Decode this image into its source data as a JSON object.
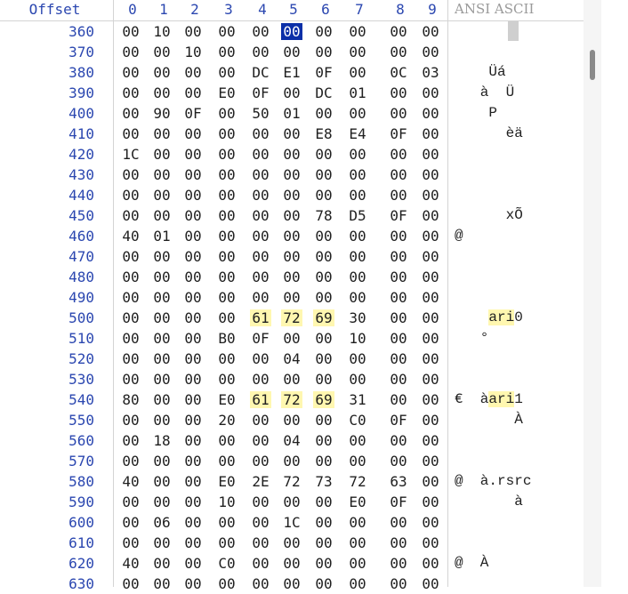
{
  "header": {
    "offset_label": "Offset",
    "columns": [
      "0",
      "1",
      "2",
      "3",
      "4",
      "5",
      "6",
      "7",
      "8",
      "9"
    ],
    "ascii_label": "ANSI ASCII"
  },
  "rows": [
    {
      "offset": "360",
      "bytes": [
        "00",
        "10",
        "00",
        "00",
        "00",
        "00",
        "00",
        "00",
        "00",
        "00"
      ],
      "ascii": ""
    },
    {
      "offset": "370",
      "bytes": [
        "00",
        "00",
        "10",
        "00",
        "00",
        "00",
        "00",
        "00",
        "00",
        "00"
      ],
      "ascii": ""
    },
    {
      "offset": "380",
      "bytes": [
        "00",
        "00",
        "00",
        "00",
        "DC",
        "E1",
        "0F",
        "00",
        "0C",
        "03"
      ],
      "ascii": "    Üá"
    },
    {
      "offset": "390",
      "bytes": [
        "00",
        "00",
        "00",
        "E0",
        "0F",
        "00",
        "DC",
        "01",
        "00",
        "00"
      ],
      "ascii": "   à  Ü"
    },
    {
      "offset": "400",
      "bytes": [
        "00",
        "90",
        "0F",
        "00",
        "50",
        "01",
        "00",
        "00",
        "00",
        "00"
      ],
      "ascii": "    P"
    },
    {
      "offset": "410",
      "bytes": [
        "00",
        "00",
        "00",
        "00",
        "00",
        "00",
        "E8",
        "E4",
        "0F",
        "00"
      ],
      "ascii": "      èä"
    },
    {
      "offset": "420",
      "bytes": [
        "1C",
        "00",
        "00",
        "00",
        "00",
        "00",
        "00",
        "00",
        "00",
        "00"
      ],
      "ascii": ""
    },
    {
      "offset": "430",
      "bytes": [
        "00",
        "00",
        "00",
        "00",
        "00",
        "00",
        "00",
        "00",
        "00",
        "00"
      ],
      "ascii": ""
    },
    {
      "offset": "440",
      "bytes": [
        "00",
        "00",
        "00",
        "00",
        "00",
        "00",
        "00",
        "00",
        "00",
        "00"
      ],
      "ascii": ""
    },
    {
      "offset": "450",
      "bytes": [
        "00",
        "00",
        "00",
        "00",
        "00",
        "00",
        "78",
        "D5",
        "0F",
        "00"
      ],
      "ascii": "      xÕ"
    },
    {
      "offset": "460",
      "bytes": [
        "40",
        "01",
        "00",
        "00",
        "00",
        "00",
        "00",
        "00",
        "00",
        "00"
      ],
      "ascii": "@"
    },
    {
      "offset": "470",
      "bytes": [
        "00",
        "00",
        "00",
        "00",
        "00",
        "00",
        "00",
        "00",
        "00",
        "00"
      ],
      "ascii": ""
    },
    {
      "offset": "480",
      "bytes": [
        "00",
        "00",
        "00",
        "00",
        "00",
        "00",
        "00",
        "00",
        "00",
        "00"
      ],
      "ascii": ""
    },
    {
      "offset": "490",
      "bytes": [
        "00",
        "00",
        "00",
        "00",
        "00",
        "00",
        "00",
        "00",
        "00",
        "00"
      ],
      "ascii": ""
    },
    {
      "offset": "500",
      "bytes": [
        "00",
        "00",
        "00",
        "00",
        "61",
        "72",
        "69",
        "30",
        "00",
        "00"
      ],
      "ascii": "    ari0",
      "ascii_hl": [
        4,
        7
      ]
    },
    {
      "offset": "510",
      "bytes": [
        "00",
        "00",
        "00",
        "B0",
        "0F",
        "00",
        "00",
        "10",
        "00",
        "00"
      ],
      "ascii": "   °"
    },
    {
      "offset": "520",
      "bytes": [
        "00",
        "00",
        "00",
        "00",
        "00",
        "04",
        "00",
        "00",
        "00",
        "00"
      ],
      "ascii": ""
    },
    {
      "offset": "530",
      "bytes": [
        "00",
        "00",
        "00",
        "00",
        "00",
        "00",
        "00",
        "00",
        "00",
        "00"
      ],
      "ascii": ""
    },
    {
      "offset": "540",
      "bytes": [
        "80",
        "00",
        "00",
        "E0",
        "61",
        "72",
        "69",
        "31",
        "00",
        "00"
      ],
      "ascii": "€  àari1",
      "ascii_hl": [
        4,
        7
      ]
    },
    {
      "offset": "550",
      "bytes": [
        "00",
        "00",
        "00",
        "20",
        "00",
        "00",
        "00",
        "C0",
        "0F",
        "00"
      ],
      "ascii": "       À"
    },
    {
      "offset": "560",
      "bytes": [
        "00",
        "18",
        "00",
        "00",
        "00",
        "04",
        "00",
        "00",
        "00",
        "00"
      ],
      "ascii": ""
    },
    {
      "offset": "570",
      "bytes": [
        "00",
        "00",
        "00",
        "00",
        "00",
        "00",
        "00",
        "00",
        "00",
        "00"
      ],
      "ascii": ""
    },
    {
      "offset": "580",
      "bytes": [
        "40",
        "00",
        "00",
        "E0",
        "2E",
        "72",
        "73",
        "72",
        "63",
        "00"
      ],
      "ascii": "@  à.rsrc"
    },
    {
      "offset": "590",
      "bytes": [
        "00",
        "00",
        "00",
        "10",
        "00",
        "00",
        "00",
        "E0",
        "0F",
        "00"
      ],
      "ascii": "       à"
    },
    {
      "offset": "600",
      "bytes": [
        "00",
        "06",
        "00",
        "00",
        "00",
        "1C",
        "00",
        "00",
        "00",
        "00"
      ],
      "ascii": ""
    },
    {
      "offset": "610",
      "bytes": [
        "00",
        "00",
        "00",
        "00",
        "00",
        "00",
        "00",
        "00",
        "00",
        "00"
      ],
      "ascii": ""
    },
    {
      "offset": "620",
      "bytes": [
        "40",
        "00",
        "00",
        "C0",
        "00",
        "00",
        "00",
        "00",
        "00",
        "00"
      ],
      "ascii": "@  À"
    },
    {
      "offset": "630",
      "bytes": [
        "00",
        "00",
        "00",
        "00",
        "00",
        "00",
        "00",
        "00",
        "00",
        "00"
      ],
      "ascii": ""
    }
  ],
  "highlights": [
    {
      "row": 14,
      "cols": [
        4,
        5,
        6
      ]
    },
    {
      "row": 18,
      "cols": [
        4,
        5,
        6
      ]
    }
  ],
  "caret": {
    "row": 0,
    "col": 5
  },
  "colors": {
    "offset_text": "#2b47b0",
    "highlight": "#fff7b0",
    "caret": "#0b2fa8"
  }
}
